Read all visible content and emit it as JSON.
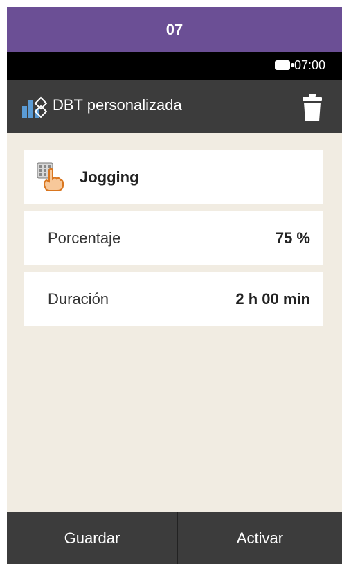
{
  "topbar": {
    "title": "07"
  },
  "statusbar": {
    "time": "07:00"
  },
  "header": {
    "title": "DBT personalizada",
    "app_icon": "dbt-building-icon",
    "delete_icon": "trash-icon"
  },
  "profile": {
    "name": "Jogging",
    "icon": "keypad-hand-icon"
  },
  "settings": [
    {
      "label": "Porcentaje",
      "value": "75 %"
    },
    {
      "label": "Duración",
      "value": "2 h 00 min"
    }
  ],
  "bottom": {
    "save_label": "Guardar",
    "activate_label": "Activar"
  },
  "colors": {
    "topbar": "#6b4f95",
    "statusbar": "#000000",
    "header": "#3c3c3c",
    "background": "#f1ece2",
    "card": "#ffffff"
  }
}
